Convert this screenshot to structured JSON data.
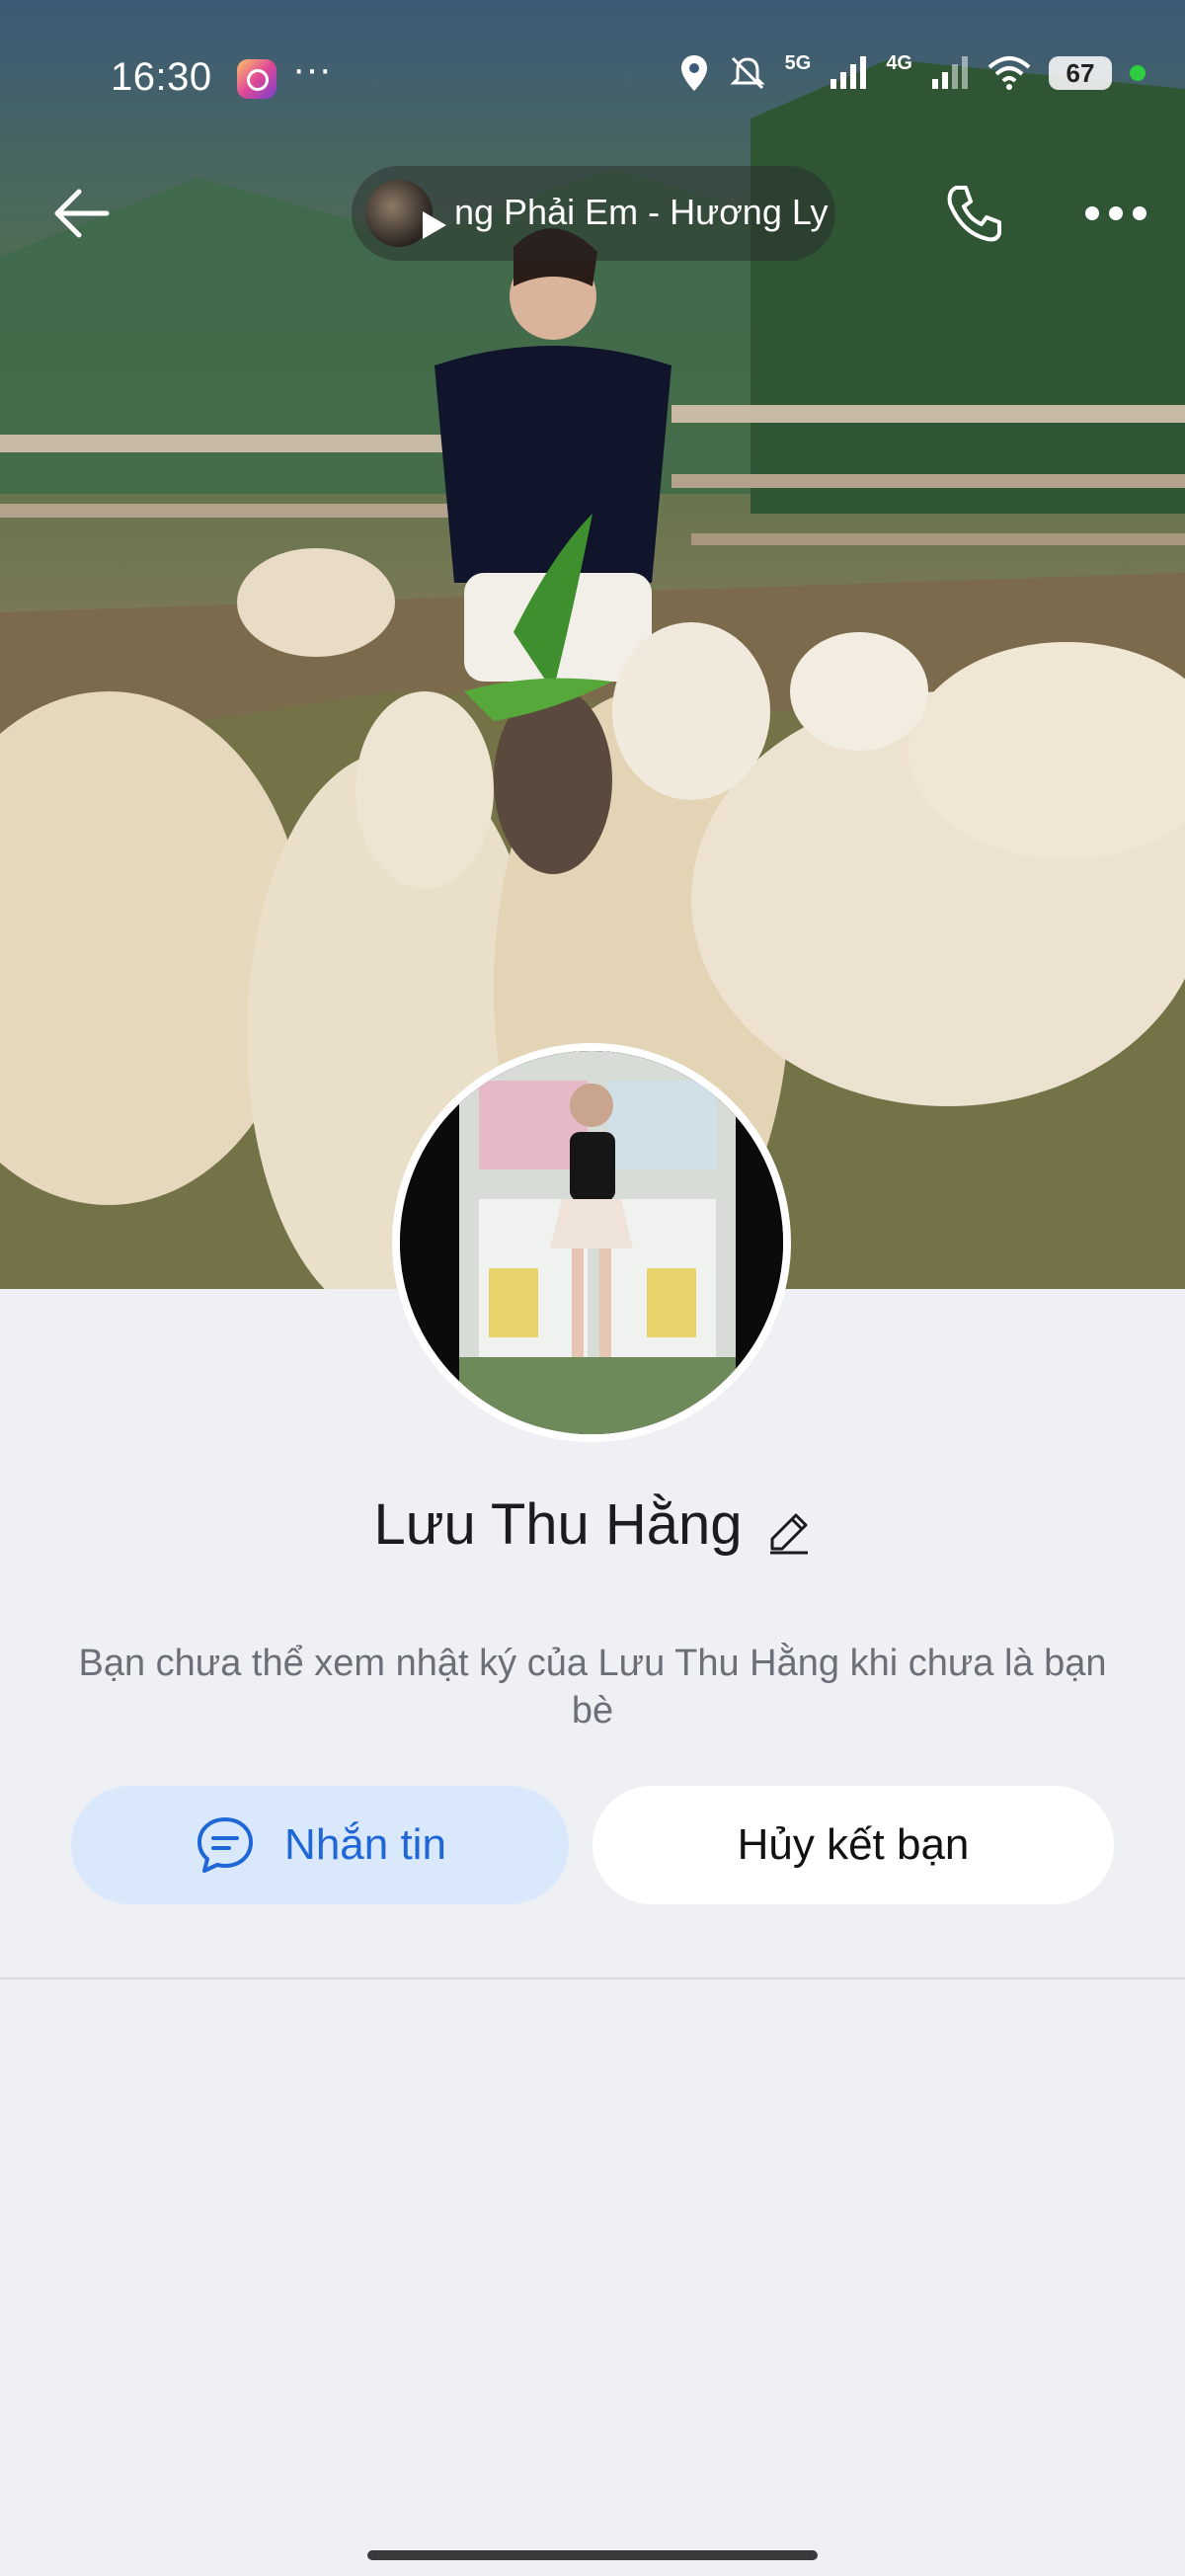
{
  "status_bar": {
    "time": "16:30",
    "dots": "···",
    "network_5g": "5G",
    "network_4g": "4G",
    "battery": "67"
  },
  "music": {
    "title": "ng Phải Em - Hương Ly"
  },
  "profile": {
    "name": "Lưu Thu Hằng",
    "privacy_note": "Bạn chưa thể xem nhật ký của Lưu Thu Hằng khi chưa là bạn bè"
  },
  "actions": {
    "message_label": "Nhắn tin",
    "unfriend_label": "Hủy kết bạn"
  },
  "icons": [
    "instagram-icon",
    "location-icon",
    "bell-off-icon",
    "signal-icon",
    "wifi-icon",
    "back-arrow-icon",
    "play-icon",
    "phone-icon",
    "more-icon",
    "edit-pencil-icon",
    "chat-icon"
  ],
  "colors": {
    "accent": "#1f66d6",
    "message_button_bg": "#d9e8fb",
    "page_bg": "#eef0f4"
  }
}
